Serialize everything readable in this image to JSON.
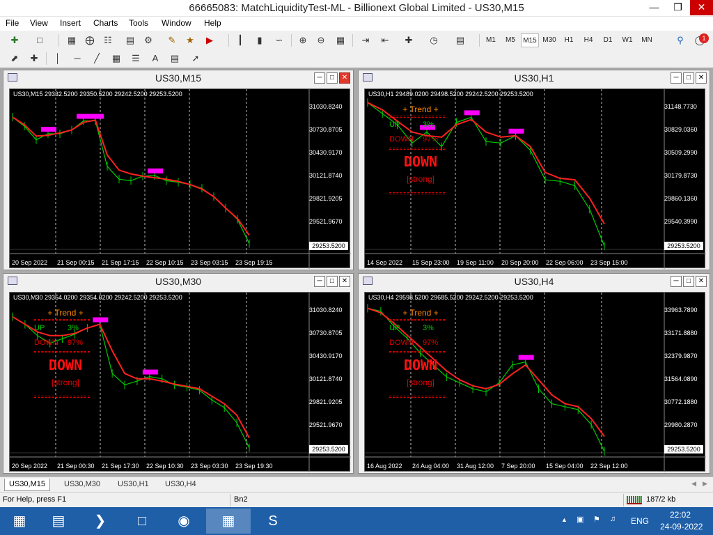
{
  "app": {
    "title": "66665083: MatchLiquidityTest-ML - Billionext Global Limited - US30,M15"
  },
  "menu": [
    "File",
    "View",
    "Insert",
    "Charts",
    "Tools",
    "Window",
    "Help"
  ],
  "timeframes": [
    "M1",
    "M5",
    "M15",
    "M30",
    "H1",
    "H4",
    "D1",
    "W1",
    "MN"
  ],
  "active_timeframe": "M15",
  "notification_count": "1",
  "colors": {
    "up": "#00cc00",
    "down": "#e00000",
    "zone": "#ff00ff",
    "zone_blue": "#1e90ff",
    "trend": "#ff8800",
    "line": "#ff2020"
  },
  "windows": [
    {
      "title": "US30,M15",
      "ohlc": "US30,M15  29332.5200  29350.5200  29242.5200  29253.5200",
      "prices": [
        "31030.8240",
        "30730.8705",
        "30430.9170",
        "30121.8740",
        "29821.9205",
        "29521.9670"
      ],
      "current_price": "29253.5200",
      "times": [
        "20 Sep 2022",
        "21 Sep 00:15",
        "21 Sep 17:15",
        "22 Sep 10:15",
        "23 Sep 03:15",
        "23 Sep 19:15"
      ],
      "has_panel": false,
      "chart_data": {
        "type": "line",
        "x": [
          "20 Sep 2022",
          "21 Sep 00:15",
          "21 Sep 17:15",
          "22 Sep 10:15",
          "23 Sep 03:15",
          "23 Sep 19:15"
        ],
        "series": [
          {
            "values": [
              31000,
              30880,
              30700,
              30780,
              30780,
              30830,
              30950,
              30950,
              30350,
              30180,
              30160,
              30220,
              30230,
              30160,
              30140,
              30110,
              30060,
              29950,
              29800,
              29650,
              29330
            ]
          },
          {
            "values": [
              31000,
              30900,
              30750,
              30760,
              30790,
              30830,
              30930,
              30960,
              30500,
              30300,
              30250,
              30220,
              30200,
              30180,
              30150,
              30110,
              30050,
              29950,
              29800,
              29660,
              29440
            ]
          }
        ],
        "ylim": [
          29253.52,
          31240
        ]
      }
    },
    {
      "title": "US30,H1",
      "ohlc": "US30,H1  29489.0200  29498.5200  29242.5200  29253.5200",
      "prices": [
        "31148.7730",
        "30829.0360",
        "30509.2990",
        "30179.8730",
        "29860.1360",
        "29540.3990"
      ],
      "current_price": "29253.5200",
      "times": [
        "14 Sep 2022",
        "15 Sep 23:00",
        "19 Sep 11:00",
        "20 Sep 20:00",
        "22 Sep 06:00",
        "23 Sep 15:00"
      ],
      "has_panel": true,
      "panel": {
        "trend": "+    Trend    +",
        "up": "UP",
        "up_pct": "3%",
        "down": "DOWN",
        "down_pct": "97%",
        "signal": "DOWN",
        "strength": "[strong]"
      },
      "chart_data": {
        "type": "line",
        "x": [
          "14 Sep 2022",
          "15 Sep 23:00",
          "19 Sep 11:00",
          "20 Sep 20:00",
          "22 Sep 06:00",
          "23 Sep 15:00"
        ],
        "series": [
          {
            "values": [
              31250,
              31100,
              30950,
              30700,
              30850,
              30650,
              30980,
              31050,
              30720,
              30700,
              30800,
              30600,
              30200,
              30180,
              30120,
              29800,
              29300
            ]
          },
          {
            "values": [
              31250,
              31150,
              31000,
              30850,
              30800,
              30780,
              30950,
              31020,
              30850,
              30780,
              30800,
              30650,
              30300,
              30220,
              30200,
              29950,
              29600
            ]
          }
        ],
        "ylim": [
          29253.52,
          31300
        ]
      }
    },
    {
      "title": "US30,M30",
      "ohlc": "US30,M30  29354.0200  29354.0200  29242.5200  29253.5200",
      "prices": [
        "31030.8240",
        "30730.8705",
        "30430.9170",
        "30121.8740",
        "29821.9205",
        "29521.9670"
      ],
      "current_price": "29253.5200",
      "times": [
        "20 Sep 2022",
        "21 Sep 00:30",
        "21 Sep 17:30",
        "22 Sep 10:30",
        "23 Sep 03:30",
        "23 Sep 19:30"
      ],
      "has_panel": true,
      "panel": {
        "trend": "+    Trend    +",
        "up": "UP",
        "up_pct": "3%",
        "down": "DOWN",
        "down_pct": "97%",
        "signal": "DOWN",
        "strength": "[strong]"
      },
      "chart_data": {
        "type": "line",
        "x": [
          "20 Sep 2022",
          "21 Sep 00:30",
          "21 Sep 17:30",
          "22 Sep 10:30",
          "23 Sep 03:30",
          "23 Sep 19:30"
        ],
        "series": [
          {
            "values": [
              31050,
              30950,
              30800,
              30700,
              30760,
              30820,
              30900,
              30950,
              30300,
              30150,
              30200,
              30260,
              30230,
              30150,
              30120,
              30080,
              29950,
              29850,
              29650,
              29320
            ]
          },
          {
            "values": [
              31050,
              30950,
              30850,
              30800,
              30800,
              30830,
              30900,
              30950,
              30600,
              30300,
              30230,
              30230,
              30200,
              30160,
              30130,
              30100,
              30000,
              29900,
              29750,
              29450
            ]
          }
        ],
        "ylim": [
          29253.52,
          31240
        ]
      }
    },
    {
      "title": "US30,H4",
      "ohlc": "US30,H4  29598.5200  29685.5200  29242.5200  29253.5200",
      "prices": [
        "33963.7890",
        "33171.8880",
        "32379.9870",
        "31564.0890",
        "30772.1880",
        "29980.2870"
      ],
      "current_price": "29253.5200",
      "times": [
        "16 Aug 2022",
        "24 Aug 04:00",
        "31 Aug 12:00",
        "7 Sep 20:00",
        "15 Sep 04:00",
        "22 Sep 12:00"
      ],
      "has_panel": true,
      "panel": {
        "trend": "+    Trend    +",
        "up": "UP",
        "up_pct": "3%",
        "down": "DOWN",
        "down_pct": "97%",
        "signal": "DOWN",
        "strength": "[strong]"
      },
      "chart_data": {
        "type": "line",
        "x": [
          "16 Aug 2022",
          "24 Aug 04:00",
          "31 Aug 12:00",
          "7 Sep 20:00",
          "15 Sep 04:00",
          "22 Sep 12:00"
        ],
        "series": [
          {
            "values": [
              34100,
              34000,
              33500,
              33100,
              32600,
              32200,
              31800,
              31600,
              31400,
              31300,
              31600,
              32200,
              32300,
              31400,
              30900,
              30800,
              30700,
              30200,
              29300
            ]
          },
          {
            "values": [
              34100,
              33950,
              33600,
              33200,
              32800,
              32400,
              32000,
              31700,
              31500,
              31400,
              31550,
              31900,
              32200,
              31700,
              31200,
              30900,
              30800,
              30400,
              29800
            ]
          }
        ],
        "ylim": [
          29253.52,
          34300
        ]
      }
    }
  ],
  "tabs": [
    "US30,M15",
    "US30,M30",
    "US30,H1",
    "US30,H4"
  ],
  "active_tab": "US30,M15",
  "status": {
    "help": "For Help, press F1",
    "profile": "Bn2",
    "traffic": "187/2 kb"
  },
  "tray": {
    "lang": "ENG",
    "time": "22:02",
    "date": "24-09-2022"
  }
}
